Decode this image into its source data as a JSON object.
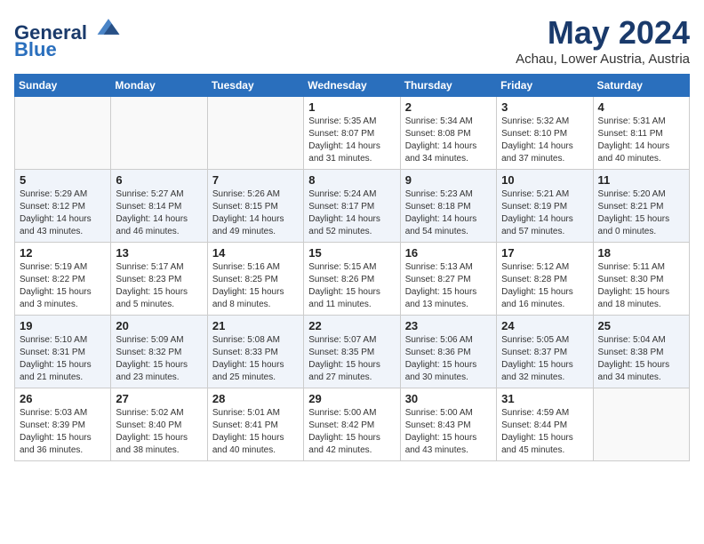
{
  "header": {
    "logo_line1": "General",
    "logo_line2": "Blue",
    "month": "May 2024",
    "location": "Achau, Lower Austria, Austria"
  },
  "weekdays": [
    "Sunday",
    "Monday",
    "Tuesday",
    "Wednesday",
    "Thursday",
    "Friday",
    "Saturday"
  ],
  "weeks": [
    [
      {
        "day": "",
        "info": ""
      },
      {
        "day": "",
        "info": ""
      },
      {
        "day": "",
        "info": ""
      },
      {
        "day": "1",
        "info": "Sunrise: 5:35 AM\nSunset: 8:07 PM\nDaylight: 14 hours\nand 31 minutes."
      },
      {
        "day": "2",
        "info": "Sunrise: 5:34 AM\nSunset: 8:08 PM\nDaylight: 14 hours\nand 34 minutes."
      },
      {
        "day": "3",
        "info": "Sunrise: 5:32 AM\nSunset: 8:10 PM\nDaylight: 14 hours\nand 37 minutes."
      },
      {
        "day": "4",
        "info": "Sunrise: 5:31 AM\nSunset: 8:11 PM\nDaylight: 14 hours\nand 40 minutes."
      }
    ],
    [
      {
        "day": "5",
        "info": "Sunrise: 5:29 AM\nSunset: 8:12 PM\nDaylight: 14 hours\nand 43 minutes."
      },
      {
        "day": "6",
        "info": "Sunrise: 5:27 AM\nSunset: 8:14 PM\nDaylight: 14 hours\nand 46 minutes."
      },
      {
        "day": "7",
        "info": "Sunrise: 5:26 AM\nSunset: 8:15 PM\nDaylight: 14 hours\nand 49 minutes."
      },
      {
        "day": "8",
        "info": "Sunrise: 5:24 AM\nSunset: 8:17 PM\nDaylight: 14 hours\nand 52 minutes."
      },
      {
        "day": "9",
        "info": "Sunrise: 5:23 AM\nSunset: 8:18 PM\nDaylight: 14 hours\nand 54 minutes."
      },
      {
        "day": "10",
        "info": "Sunrise: 5:21 AM\nSunset: 8:19 PM\nDaylight: 14 hours\nand 57 minutes."
      },
      {
        "day": "11",
        "info": "Sunrise: 5:20 AM\nSunset: 8:21 PM\nDaylight: 15 hours\nand 0 minutes."
      }
    ],
    [
      {
        "day": "12",
        "info": "Sunrise: 5:19 AM\nSunset: 8:22 PM\nDaylight: 15 hours\nand 3 minutes."
      },
      {
        "day": "13",
        "info": "Sunrise: 5:17 AM\nSunset: 8:23 PM\nDaylight: 15 hours\nand 5 minutes."
      },
      {
        "day": "14",
        "info": "Sunrise: 5:16 AM\nSunset: 8:25 PM\nDaylight: 15 hours\nand 8 minutes."
      },
      {
        "day": "15",
        "info": "Sunrise: 5:15 AM\nSunset: 8:26 PM\nDaylight: 15 hours\nand 11 minutes."
      },
      {
        "day": "16",
        "info": "Sunrise: 5:13 AM\nSunset: 8:27 PM\nDaylight: 15 hours\nand 13 minutes."
      },
      {
        "day": "17",
        "info": "Sunrise: 5:12 AM\nSunset: 8:28 PM\nDaylight: 15 hours\nand 16 minutes."
      },
      {
        "day": "18",
        "info": "Sunrise: 5:11 AM\nSunset: 8:30 PM\nDaylight: 15 hours\nand 18 minutes."
      }
    ],
    [
      {
        "day": "19",
        "info": "Sunrise: 5:10 AM\nSunset: 8:31 PM\nDaylight: 15 hours\nand 21 minutes."
      },
      {
        "day": "20",
        "info": "Sunrise: 5:09 AM\nSunset: 8:32 PM\nDaylight: 15 hours\nand 23 minutes."
      },
      {
        "day": "21",
        "info": "Sunrise: 5:08 AM\nSunset: 8:33 PM\nDaylight: 15 hours\nand 25 minutes."
      },
      {
        "day": "22",
        "info": "Sunrise: 5:07 AM\nSunset: 8:35 PM\nDaylight: 15 hours\nand 27 minutes."
      },
      {
        "day": "23",
        "info": "Sunrise: 5:06 AM\nSunset: 8:36 PM\nDaylight: 15 hours\nand 30 minutes."
      },
      {
        "day": "24",
        "info": "Sunrise: 5:05 AM\nSunset: 8:37 PM\nDaylight: 15 hours\nand 32 minutes."
      },
      {
        "day": "25",
        "info": "Sunrise: 5:04 AM\nSunset: 8:38 PM\nDaylight: 15 hours\nand 34 minutes."
      }
    ],
    [
      {
        "day": "26",
        "info": "Sunrise: 5:03 AM\nSunset: 8:39 PM\nDaylight: 15 hours\nand 36 minutes."
      },
      {
        "day": "27",
        "info": "Sunrise: 5:02 AM\nSunset: 8:40 PM\nDaylight: 15 hours\nand 38 minutes."
      },
      {
        "day": "28",
        "info": "Sunrise: 5:01 AM\nSunset: 8:41 PM\nDaylight: 15 hours\nand 40 minutes."
      },
      {
        "day": "29",
        "info": "Sunrise: 5:00 AM\nSunset: 8:42 PM\nDaylight: 15 hours\nand 42 minutes."
      },
      {
        "day": "30",
        "info": "Sunrise: 5:00 AM\nSunset: 8:43 PM\nDaylight: 15 hours\nand 43 minutes."
      },
      {
        "day": "31",
        "info": "Sunrise: 4:59 AM\nSunset: 8:44 PM\nDaylight: 15 hours\nand 45 minutes."
      },
      {
        "day": "",
        "info": ""
      }
    ]
  ]
}
